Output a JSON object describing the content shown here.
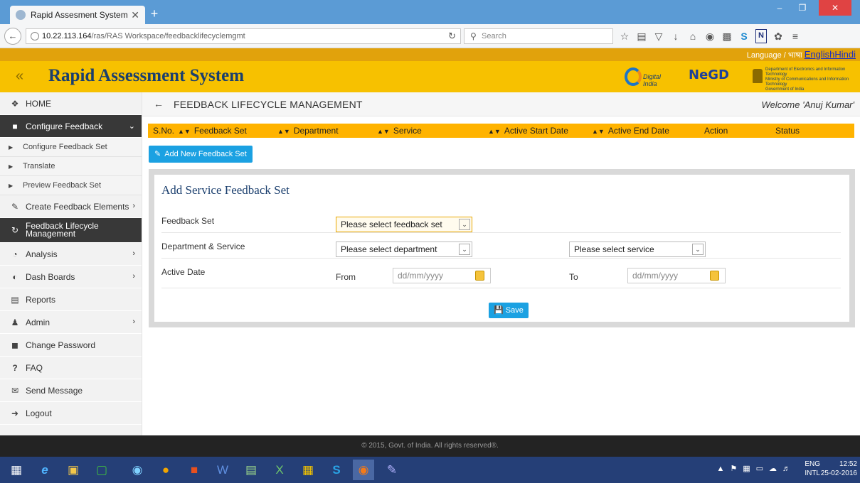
{
  "browser": {
    "tab_title": "Rapid Assesment System: ...",
    "tab_close": "✕",
    "new_tab": "+",
    "url_host": "10.22.113.164",
    "url_path": "/ras/RAS Workspace/feedbacklifecyclemgmt",
    "search_placeholder": "Search",
    "win_min": "–",
    "win_max": "❐",
    "win_close": "✕"
  },
  "app": {
    "language_label": "Language / भाषा",
    "language_options": "EnglishHindi",
    "title": "Rapid Assessment System",
    "collapse_glyph": "«",
    "logos": {
      "digital_india": "Digital India",
      "negd": "NeGD",
      "deity_line1": "Department of Electronics and Information Technology",
      "deity_line2": "Ministry of Communications and Information Technology",
      "deity_line3": "Government of India"
    }
  },
  "sidebar": {
    "items": [
      {
        "label": "HOME",
        "icon": "home-icon"
      },
      {
        "label": "Configure Feedback",
        "icon": "document-icon"
      },
      {
        "label": "Configure Feedback Set"
      },
      {
        "label": "Translate"
      },
      {
        "label": "Preview Feedback Set"
      },
      {
        "label": "Create Feedback Elements",
        "icon": "pencil-icon"
      },
      {
        "label": "Feedback Lifecycle Management",
        "icon": "refresh-icon"
      },
      {
        "label": "Analysis",
        "icon": "pie-chart-icon"
      },
      {
        "label": "Dash Boards",
        "icon": "dashboard-icon"
      },
      {
        "label": "Reports",
        "icon": "reports-icon"
      },
      {
        "label": "Admin",
        "icon": "user-icon"
      },
      {
        "label": "Change Password",
        "icon": "lock-icon"
      },
      {
        "label": "FAQ",
        "icon": "question-icon"
      },
      {
        "label": "Send Message",
        "icon": "envelope-icon"
      },
      {
        "label": "Logout",
        "icon": "logout-icon"
      }
    ]
  },
  "main": {
    "page_title": "FEEDBACK LIFECYCLE MANAGEMENT",
    "welcome": "Welcome 'Anuj Kumar'",
    "columns": [
      "S.No.",
      "Feedback Set",
      "Department",
      "Service",
      "Active Start Date",
      "Active End Date",
      "Action",
      "Status"
    ],
    "add_button": "Add New Feedback Set",
    "form": {
      "title": "Add Service Feedback Set",
      "feedback_set_label": "Feedback Set",
      "feedback_set_value": "Please select feedback set",
      "dept_service_label": "Department & Service",
      "department_value": "Please select department",
      "service_value": "Please select service",
      "active_date_label": "Active Date",
      "from_label": "From",
      "to_label": "To",
      "date_placeholder": "dd/mm/yyyy",
      "save_button": "Save"
    }
  },
  "footer": {
    "text": "© 2015, Govt. of India. All rights reserved®."
  },
  "taskbar": {
    "lang_line1": "ENG",
    "lang_line2": "INTL",
    "time": "12:52",
    "date": "25-02-2016"
  }
}
